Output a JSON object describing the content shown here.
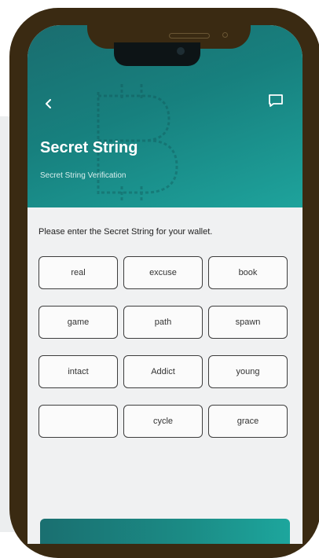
{
  "header": {
    "title": "Secret String",
    "subtitle": "Secret String Verification",
    "back_icon": "chevron-left-icon",
    "chat_icon": "chat-icon"
  },
  "instruction": "Please enter the Secret String for your wallet.",
  "words": [
    "real",
    "excuse",
    "book",
    "game",
    "path",
    "spawn",
    "intact",
    "Addict",
    "young",
    "",
    "cycle",
    "grace"
  ],
  "colors": {
    "frame": "#3a2a12",
    "header_start": "#1a6d6f",
    "header_end": "#1ea39c",
    "button": "#1b8c86"
  }
}
